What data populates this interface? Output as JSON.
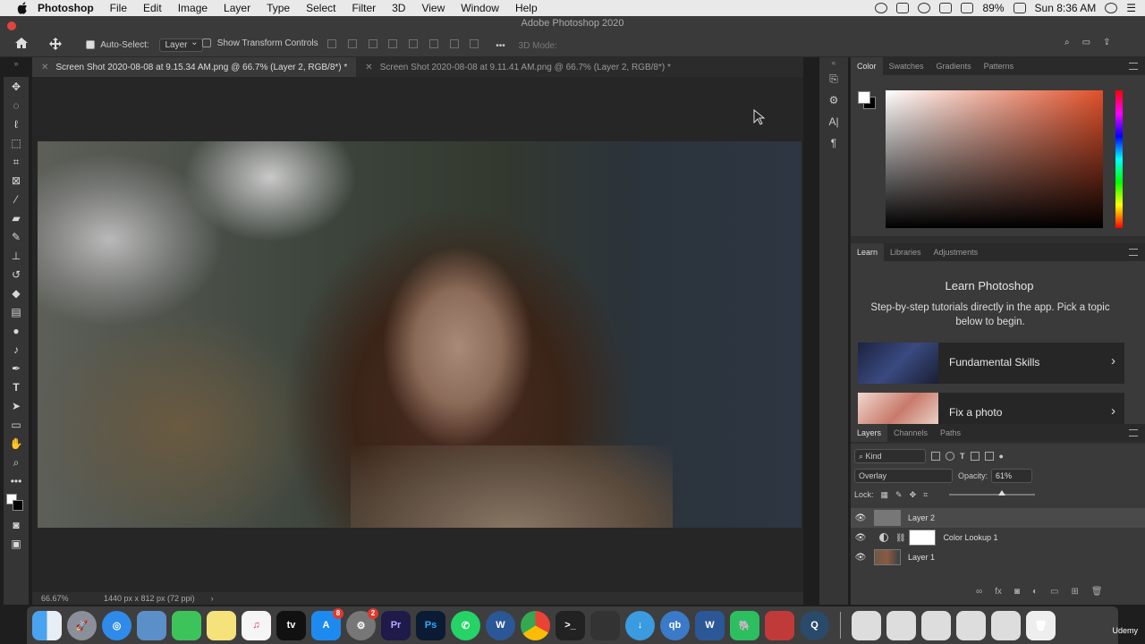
{
  "menubar": {
    "app": "Photoshop",
    "items": [
      "File",
      "Edit",
      "Image",
      "Layer",
      "Type",
      "Select",
      "Filter",
      "3D",
      "View",
      "Window",
      "Help"
    ],
    "battery": "89%",
    "clock": "Sun 8:36 AM"
  },
  "window": {
    "title": "Adobe Photoshop 2020"
  },
  "options": {
    "auto_select_label": "Auto-Select:",
    "auto_select_target": "Layer",
    "transform_label": "Show Transform Controls",
    "mode_3d": "3D Mode:"
  },
  "tabs": [
    {
      "label": "Screen Shot 2020-08-08 at 9.15.34 AM.png @ 66.7% (Layer 2, RGB/8*) *",
      "active": true
    },
    {
      "label": "Screen Shot 2020-08-08 at 9.11.41 AM.png @ 66.7% (Layer 2, RGB/8*) *",
      "active": false
    }
  ],
  "status": {
    "zoom": "66.67%",
    "doc_info": "1440 px x 812 px (72 ppi)"
  },
  "color_panel": {
    "tabs": [
      "Color",
      "Swatches",
      "Gradients",
      "Patterns"
    ]
  },
  "learn_panel": {
    "tabs": [
      "Learn",
      "Libraries",
      "Adjustments"
    ],
    "title": "Learn Photoshop",
    "description": "Step-by-step tutorials directly in the app. Pick a topic below to begin.",
    "cards": [
      "Fundamental Skills",
      "Fix a photo"
    ]
  },
  "layers_panel": {
    "tabs": [
      "Layers",
      "Channels",
      "Paths"
    ],
    "filter": "Kind",
    "blend_mode": "Overlay",
    "opacity_label": "Opacity:",
    "opacity_value": "61%",
    "lock_label": "Lock:",
    "layers": [
      {
        "name": "Layer 2",
        "selected": true
      },
      {
        "name": "Color Lookup 1",
        "selected": false
      },
      {
        "name": "Layer 1",
        "selected": false
      }
    ]
  },
  "dock": {
    "apps": [
      "Finder",
      "Launchpad",
      "Safari",
      "Preview",
      "FaceTime",
      "Notes",
      "Music",
      "TV",
      "App Store",
      "System Preferences",
      "Premiere Pro",
      "Photoshop",
      "WhatsApp",
      "Word",
      "Chrome",
      "Terminal",
      "Activity Monitor",
      "Downloader",
      "qBittorrent",
      "Word",
      "Evernote",
      "Photo Booth",
      "QuickTime"
    ],
    "app_store_badge": "8",
    "prefs_badge": "2",
    "tv_label": "tv",
    "pr_label": "Pr",
    "ps_label": "Ps",
    "qb_label": "qb",
    "w_label": "W"
  },
  "branding": {
    "udemy": "Udemy"
  }
}
